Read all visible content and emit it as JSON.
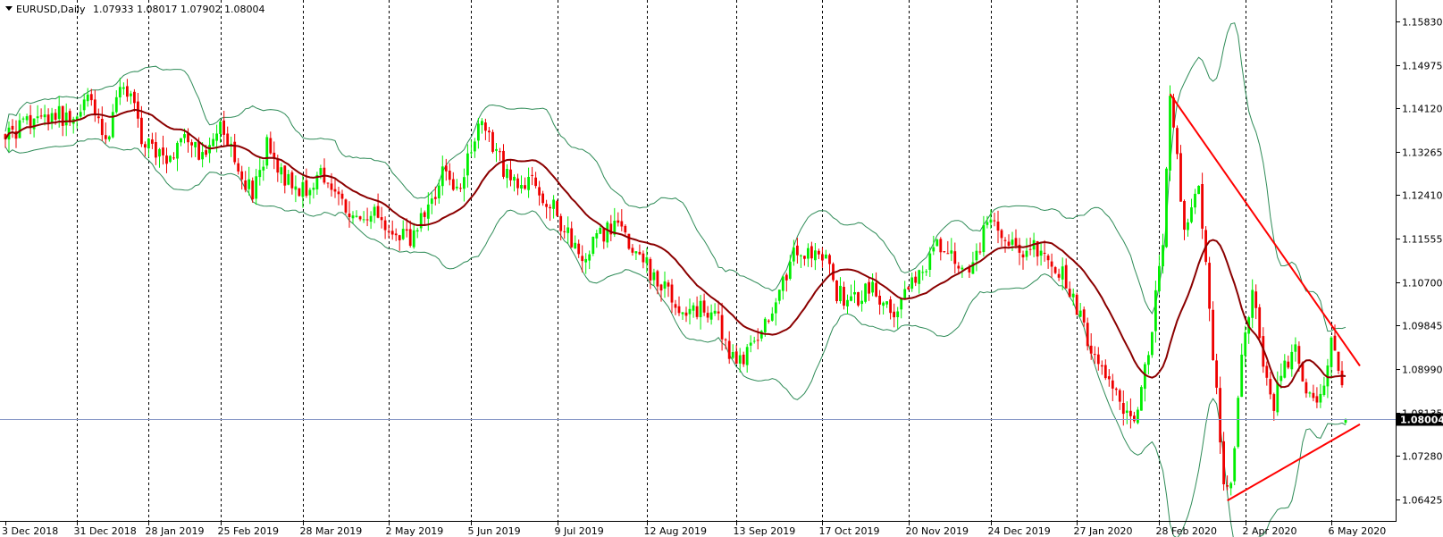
{
  "header": {
    "symbol_label": "EURUSD,Daily",
    "ohlc_label": "1.07933 1.08017 1.07902 1.08004"
  },
  "current_price_label": "1.08004",
  "colors": {
    "bull_candle": "#00ee00",
    "bear_candle": "#ee0000",
    "bollinger_band": "#2e8b57",
    "moving_average": "#8b0000",
    "trendline": "#ff0000",
    "price_line": "#8a9ac8",
    "background": "#ffffff",
    "price_tag_bg": "#000000"
  },
  "chart_data": {
    "type": "candlestick",
    "symbol": "EURUSD",
    "timeframe": "Daily",
    "ylim": [
      1.06,
      1.1625
    ],
    "y_ticks": [
      {
        "value": 1.1583,
        "label": "1.15830"
      },
      {
        "value": 1.14975,
        "label": "1.14975"
      },
      {
        "value": 1.1412,
        "label": "1.14120"
      },
      {
        "value": 1.13265,
        "label": "1.13265"
      },
      {
        "value": 1.1241,
        "label": "1.12410"
      },
      {
        "value": 1.11555,
        "label": "1.11555"
      },
      {
        "value": 1.107,
        "label": "1.10700"
      },
      {
        "value": 1.09845,
        "label": "1.09845"
      },
      {
        "value": 1.0899,
        "label": "1.08990"
      },
      {
        "value": 1.08135,
        "label": "1.08135"
      },
      {
        "value": 1.0728,
        "label": "1.07280"
      },
      {
        "value": 1.06425,
        "label": "1.06425"
      }
    ],
    "x_ticks": [
      {
        "index": 0,
        "label": "3 Dec 2018"
      },
      {
        "index": 20,
        "label": "31 Dec 2018"
      },
      {
        "index": 40,
        "label": "28 Jan 2019"
      },
      {
        "index": 60,
        "label": "25 Feb 2019"
      },
      {
        "index": 83,
        "label": "28 Mar 2019"
      },
      {
        "index": 107,
        "label": "2 May 2019"
      },
      {
        "index": 130,
        "label": "5 Jun 2019"
      },
      {
        "index": 154,
        "label": "9 Jul 2019"
      },
      {
        "index": 179,
        "label": "12 Aug 2019"
      },
      {
        "index": 204,
        "label": "13 Sep 2019"
      },
      {
        "index": 228,
        "label": "17 Oct 2019"
      },
      {
        "index": 252,
        "label": "20 Nov 2019"
      },
      {
        "index": 275,
        "label": "24 Dec 2019"
      },
      {
        "index": 299,
        "label": "27 Jan 2020"
      },
      {
        "index": 322,
        "label": "28 Feb 2020"
      },
      {
        "index": 346,
        "label": "2 Apr 2020"
      },
      {
        "index": 370,
        "label": "6 May 2020"
      }
    ],
    "last_bar": {
      "open": 1.07933,
      "high": 1.08017,
      "low": 1.07902,
      "close": 1.08004
    },
    "current_price": 1.08004,
    "close_anchors": [
      [
        0,
        1.135
      ],
      [
        8,
        1.139
      ],
      [
        14,
        1.14
      ],
      [
        19,
        1.139
      ],
      [
        24,
        1.143
      ],
      [
        28,
        1.135
      ],
      [
        33,
        1.147
      ],
      [
        38,
        1.136
      ],
      [
        45,
        1.13
      ],
      [
        50,
        1.136
      ],
      [
        55,
        1.132
      ],
      [
        60,
        1.137
      ],
      [
        65,
        1.13
      ],
      [
        69,
        1.124
      ],
      [
        73,
        1.134
      ],
      [
        77,
        1.128
      ],
      [
        83,
        1.125
      ],
      [
        88,
        1.128
      ],
      [
        93,
        1.123
      ],
      [
        98,
        1.12
      ],
      [
        103,
        1.12
      ],
      [
        107,
        1.118
      ],
      [
        113,
        1.116
      ],
      [
        118,
        1.121
      ],
      [
        122,
        1.129
      ],
      [
        126,
        1.124
      ],
      [
        130,
        1.134
      ],
      [
        133,
        1.138
      ],
      [
        137,
        1.133
      ],
      [
        141,
        1.126
      ],
      [
        146,
        1.127
      ],
      [
        152,
        1.123
      ],
      [
        157,
        1.116
      ],
      [
        161,
        1.112
      ],
      [
        165,
        1.116
      ],
      [
        171,
        1.118
      ],
      [
        176,
        1.113
      ],
      [
        181,
        1.108
      ],
      [
        186,
        1.104
      ],
      [
        190,
        1.1
      ],
      [
        194,
        1.102
      ],
      [
        199,
        1.099
      ],
      [
        204,
        1.09
      ],
      [
        208,
        1.095
      ],
      [
        212,
        1.099
      ],
      [
        216,
        1.104
      ],
      [
        220,
        1.114
      ],
      [
        225,
        1.112
      ],
      [
        229,
        1.112
      ],
      [
        232,
        1.105
      ],
      [
        236,
        1.103
      ],
      [
        241,
        1.106
      ],
      [
        245,
        1.103
      ],
      [
        249,
        1.101
      ],
      [
        252,
        1.107
      ],
      [
        256,
        1.109
      ],
      [
        260,
        1.114
      ],
      [
        264,
        1.112
      ],
      [
        268,
        1.109
      ],
      [
        271,
        1.113
      ],
      [
        275,
        1.12
      ],
      [
        279,
        1.116
      ],
      [
        283,
        1.113
      ],
      [
        287,
        1.114
      ],
      [
        291,
        1.111
      ],
      [
        295,
        1.109
      ],
      [
        299,
        1.102
      ],
      [
        303,
        1.094
      ],
      [
        307,
        1.087
      ],
      [
        311,
        1.083
      ],
      [
        314,
        1.079
      ],
      [
        317,
        1.085
      ],
      [
        320,
        1.098
      ],
      [
        323,
        1.115
      ],
      [
        325,
        1.143
      ],
      [
        329,
        1.118
      ],
      [
        333,
        1.125
      ],
      [
        336,
        1.102
      ],
      [
        338,
        1.085
      ],
      [
        340,
        1.068
      ],
      [
        342,
        1.066
      ],
      [
        344,
        1.085
      ],
      [
        346,
        1.097
      ],
      [
        348,
        1.104
      ],
      [
        351,
        1.092
      ],
      [
        354,
        1.083
      ],
      [
        357,
        1.091
      ],
      [
        360,
        1.094
      ],
      [
        363,
        1.086
      ],
      [
        366,
        1.082
      ],
      [
        368,
        1.088
      ],
      [
        370,
        1.096
      ],
      [
        372,
        1.09
      ],
      [
        374,
        1.08
      ]
    ],
    "trendlines": [
      {
        "name": "upper",
        "start": [
          325,
          1.144
        ],
        "end": [
          378,
          1.0905
        ]
      },
      {
        "name": "lower",
        "start": [
          341,
          1.064
        ],
        "end": [
          378,
          1.079
        ]
      }
    ],
    "indicators": [
      "Bollinger Bands (20)",
      "Moving Average (20)"
    ],
    "grid": "vertical-dashed",
    "legend": "none"
  }
}
